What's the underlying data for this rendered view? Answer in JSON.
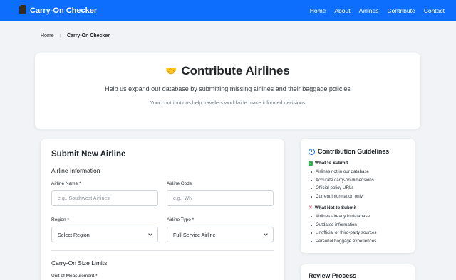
{
  "nav": {
    "brand": "Carry-On Checker",
    "links": [
      "Home",
      "About",
      "Airlines",
      "Contribute",
      "Contact"
    ]
  },
  "breadcrumb": {
    "home": "Home",
    "separator": "›",
    "current": "Carry-On Checker"
  },
  "hero": {
    "emoji": "🤝",
    "title": "Contribute Airlines",
    "subtitle": "Help us expand our database by submitting missing airlines and their baggage policies",
    "note": "Your contributions help travelers worldwide make informed decisions"
  },
  "form": {
    "title": "Submit New Airline",
    "section_info": "Airline Information",
    "airline_name_label": "Airline Name *",
    "airline_name_placeholder": "e.g., Southwest Airlines",
    "airline_code_label": "Airline Code",
    "airline_code_placeholder": "e.g., WN",
    "region_label": "Region *",
    "region_value": "Select Region",
    "type_label": "Airline Type *",
    "type_value": "Full-Service Airline",
    "section_size": "Carry-On Size Limits",
    "unit_label": "Unit of Measurement *"
  },
  "guidelines": {
    "title": "Contribution Guidelines",
    "what_to_submit": "What to Submit",
    "submit_items": [
      "Airlines not in our database",
      "Accurate carry-on dimensions",
      "Official policy URLs",
      "Current information only"
    ],
    "what_not": "What Not to Submit",
    "not_items": [
      "Airlines already in database",
      "Outdated information",
      "Unofficial or third-party sources",
      "Personal baggage experiences"
    ]
  },
  "review": {
    "title": "Review Process"
  },
  "colors": {
    "primary": "#0d6efd",
    "success": "#2fb344",
    "danger": "#dc3545"
  }
}
